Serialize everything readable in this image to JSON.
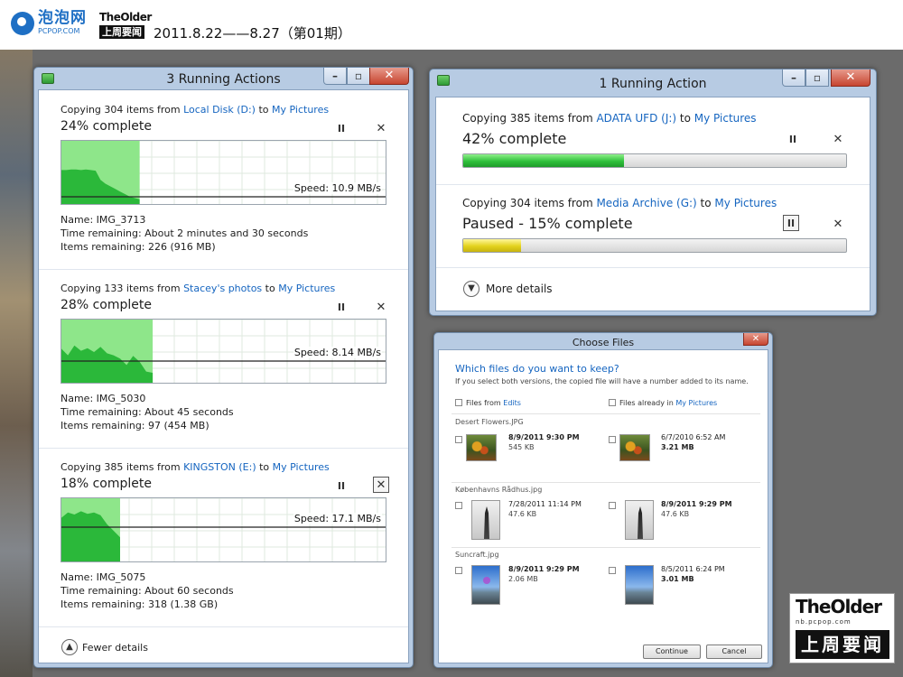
{
  "header": {
    "logo_cn": "泡泡网",
    "logo_en": "PCPOP.COM",
    "logo2_top": "TheOlder",
    "logo2_bottom": "上周要闻",
    "date_text": "2011.8.22——8.27（第01期）"
  },
  "left_window": {
    "title": "3 Running Actions",
    "items": [
      {
        "prefix": "Copying 304 items from ",
        "source": "Local Disk (D:)",
        "to": " to ",
        "dest": "My Pictures",
        "percent_text": "24% complete",
        "progress": 0.24,
        "speed": "Speed: 10.9 MB/s",
        "name": "Name:  IMG_3713",
        "time": "Time remaining:  About 2 minutes and 30 seconds",
        "remaining": "Items remaining:  226 (916 MB)"
      },
      {
        "prefix": "Copying 133 items from ",
        "source": "Stacey's photos",
        "to": " to ",
        "dest": "My Pictures",
        "percent_text": "28% complete",
        "progress": 0.28,
        "speed": "Speed: 8.14 MB/s",
        "name": "Name:  IMG_5030",
        "time": "Time remaining:  About 45 seconds",
        "remaining": "Items remaining:  97 (454 MB)"
      },
      {
        "prefix": "Copying 385 items from ",
        "source": "KINGSTON (E:)",
        "to": " to ",
        "dest": "My Pictures",
        "percent_text": "18% complete",
        "progress": 0.18,
        "speed": "Speed: 17.1 MB/s",
        "name": "Name:  IMG_5075",
        "time": "Time remaining:  About 60 seconds",
        "remaining": "Items remaining:  318 (1.38 GB)"
      }
    ],
    "pause_glyph": "II",
    "cancel_glyph": "✕",
    "details_toggle": "Fewer details"
  },
  "right_window": {
    "title": "1 Running Action",
    "items": [
      {
        "prefix": "Copying 385 items from ",
        "source": "ADATA UFD (J:)",
        "to": " to ",
        "dest": "My Pictures",
        "percent_text": "42% complete",
        "progress": 0.42,
        "bar_color": "#2fc03b"
      },
      {
        "prefix": "Copying 304 items from ",
        "source": "Media Archive (G:)",
        "to": " to ",
        "dest": "My Pictures",
        "percent_text": "Paused - 15% complete",
        "progress": 0.15,
        "bar_color": "#e3d21d"
      }
    ],
    "details_toggle": "More details"
  },
  "choose_files": {
    "title": "Choose Files",
    "question": "Which files do you want to keep?",
    "subtitle": "If you select both versions, the copied file will have a number added to its name.",
    "col_left_prefix": "Files from ",
    "col_left_link": "Edits",
    "col_right_prefix": "Files already in ",
    "col_right_link": "My Pictures",
    "files": [
      {
        "name": "Desert Flowers.JPG",
        "left_date": "8/9/2011 9:30 PM",
        "left_size": "545 KB",
        "right_date": "6/7/2010 6:52 AM",
        "right_size": "3.21 MB"
      },
      {
        "name": "Københavns Rådhus.jpg",
        "left_date": "7/28/2011 11:14 PM",
        "left_size": "47.6 KB",
        "right_date": "8/9/2011 9:29 PM",
        "right_size": "47.6 KB"
      },
      {
        "name": "Suncraft.jpg",
        "left_date": "8/9/2011 9:29 PM",
        "left_size": "2.06 MB",
        "right_date": "8/5/2011 6:24 PM",
        "right_size": "3.01 MB"
      }
    ],
    "continue_label": "Continue",
    "cancel_label": "Cancel"
  },
  "badge": {
    "top": "TheOlder",
    "mid": "nb.pcpop.com",
    "bottom": "上周要闻"
  },
  "colors": {
    "link": "#1565c0",
    "graph_fill": "#2bb83a",
    "graph_done_bg": "#8ee68a",
    "progress_green": "#2fc03b",
    "progress_yellow": "#e3d21d",
    "stage_gray": "#6b6b6b"
  }
}
